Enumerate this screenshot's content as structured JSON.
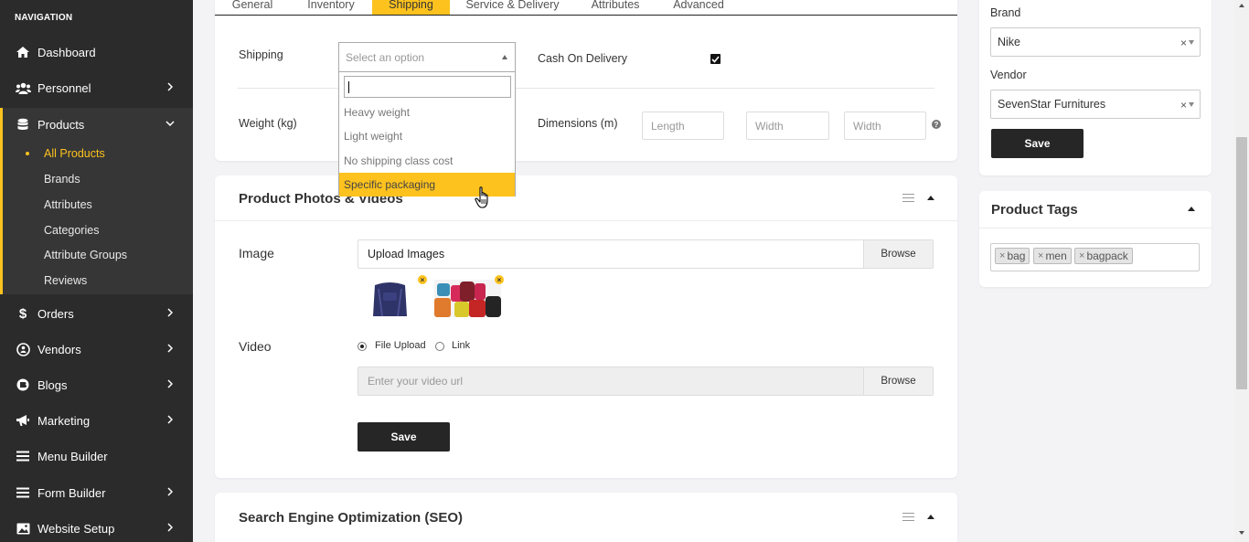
{
  "sidebar": {
    "heading": "NAVIGATION",
    "items": {
      "dashboard": "Dashboard",
      "personnel": "Personnel",
      "products": "Products",
      "orders": "Orders",
      "vendors": "Vendors",
      "blogs": "Blogs",
      "marketing": "Marketing",
      "menu_builder": "Menu Builder",
      "form_builder": "Form Builder",
      "website_setup": "Website Setup"
    },
    "products_sub": {
      "all_products": "All Products",
      "brands": "Brands",
      "attributes": "Attributes",
      "categories": "Categories",
      "attribute_groups": "Attribute Groups",
      "reviews": "Reviews"
    }
  },
  "tabs": {
    "general": "General",
    "inventory": "Inventory",
    "shipping": "Shipping",
    "service_delivery": "Service & Delivery",
    "attributes": "Attributes",
    "advanced": "Advanced"
  },
  "shipping": {
    "shipping_label": "Shipping",
    "select_placeholder": "Select an option",
    "search_value": "",
    "options": {
      "heavy": "Heavy weight",
      "light": "Light weight",
      "none": "No shipping class cost",
      "specific": "Specific packaging"
    },
    "cod_label": "Cash On Delivery",
    "cod_checked": true,
    "weight_label": "Weight (kg)",
    "dimensions_label": "Dimensions (m)",
    "length_placeholder": "Length",
    "width_placeholder": "Width",
    "height_placeholder": "Width"
  },
  "photos": {
    "title": "Product Photos & Videos",
    "image_label": "Image",
    "upload_text": "Upload Images",
    "browse": "Browse",
    "remove_symbol": "×",
    "video_label": "Video",
    "file_upload": "File Upload",
    "link": "Link",
    "video_placeholder": "Enter your video url",
    "save": "Save"
  },
  "seo": {
    "title": "Search Engine Optimization (SEO)"
  },
  "right_panel": {
    "brand_label": "Brand",
    "brand_value": "Nike",
    "vendor_label": "Vendor",
    "vendor_value": "SevenStar Furnitures",
    "clear_symbol": "×",
    "save": "Save"
  },
  "tags": {
    "title": "Product Tags",
    "remove_symbol": "×",
    "items": [
      "bag",
      "men",
      "bagpack"
    ]
  },
  "colors": {
    "accent": "#fdc21e",
    "sidebar_bg": "#2b2b2b",
    "button_dark": "#262626"
  }
}
